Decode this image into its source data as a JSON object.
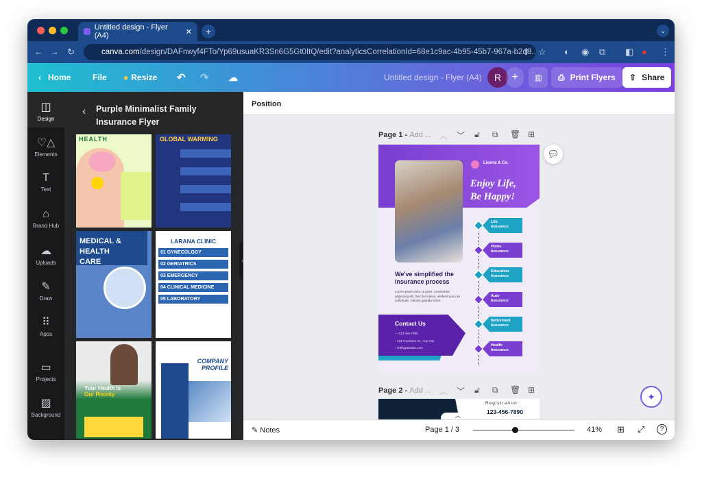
{
  "browser": {
    "tab_title": "Untitled design - Flyer (A4)",
    "url_host": "canva.com",
    "url_path": "/design/DAFnwyf4FTo/Yp69usuaKR3Sn6G5Gt0ItQ/edit?analyticsCorrelationId=68e1c9ac-4b95-45b7-967a-b2d8..."
  },
  "toolbar": {
    "home": "Home",
    "file": "File",
    "resize": "Resize",
    "doc_title": "Untitled design - Flyer (A4)",
    "avatar": "R",
    "print": "Print Flyers",
    "share": "Share"
  },
  "rail": [
    {
      "label": "Design",
      "icon": "layout-icon"
    },
    {
      "label": "Elements",
      "icon": "shapes-icon"
    },
    {
      "label": "Text",
      "icon": "text-icon"
    },
    {
      "label": "Brand Hub",
      "icon": "brand-icon"
    },
    {
      "label": "Uploads",
      "icon": "cloud-upload-icon"
    },
    {
      "label": "Draw",
      "icon": "pen-icon"
    },
    {
      "label": "Apps",
      "icon": "grid-icon"
    },
    {
      "label": "Projects",
      "icon": "folder-icon"
    },
    {
      "label": "Background",
      "icon": "pattern-icon"
    }
  ],
  "panel": {
    "title": "Purple Minimalist Family Insurance Flyer",
    "templates": [
      {
        "title": "HEALTH"
      },
      {
        "title": "GLOBAL WARMING"
      },
      {
        "title": "MEDICAL & HEALTH CARE"
      },
      {
        "title": "LARANA CLINIC",
        "items": [
          "01 GYNECOLOGY",
          "02 GERIATRICS",
          "03 EMERGENCY",
          "04 CLINICAL MEDICINE",
          "05 LABORATORY"
        ]
      },
      {
        "title": "Your Health Is",
        "subtitle": "Our Priority"
      },
      {
        "title": "COMPANY PROFILE"
      }
    ]
  },
  "position_label": "Position",
  "pages": [
    {
      "label": "Page 1 -",
      "placeholder": "Add ..."
    },
    {
      "label": "Page 2 -",
      "placeholder": "Add ..."
    }
  ],
  "flyer": {
    "brand": "Liceria & Co.",
    "headline1": "Enjoy Life,",
    "headline2": "Be Happy!",
    "subhead": "We've simplified the insurance process",
    "body": "Lorem ipsum dolor sit amet, consectetur adipiscing elit. Sed dui massa, eleifend quis nisi sollicitudin, lobortis gravida lorem.",
    "contact_title": "Contact Us",
    "phone": "+123-456-7890",
    "address": "123 Anywhere St., Any City",
    "website": "reallygreatsite.com",
    "services": [
      {
        "l1": "Life",
        "l2": "Insurance",
        "color": "#1fa3c4"
      },
      {
        "l1": "Home",
        "l2": "Insurance",
        "color": "#7a3fd0"
      },
      {
        "l1": "Education",
        "l2": "Insurance",
        "color": "#1fa3c4"
      },
      {
        "l1": "Auto",
        "l2": "Insurance",
        "color": "#7a3fd0"
      },
      {
        "l1": "Retirement",
        "l2": "Insurance",
        "color": "#1fa3c4"
      },
      {
        "l1": "Health",
        "l2": "Insurance",
        "color": "#7a3fd0"
      }
    ]
  },
  "page2": {
    "reg_label": "Registration:",
    "reg_phone": "123-456-7890"
  },
  "bottom": {
    "notes": "Notes",
    "page_indicator": "Page 1 / 3",
    "zoom": "41%",
    "zoom_percent": 41
  }
}
